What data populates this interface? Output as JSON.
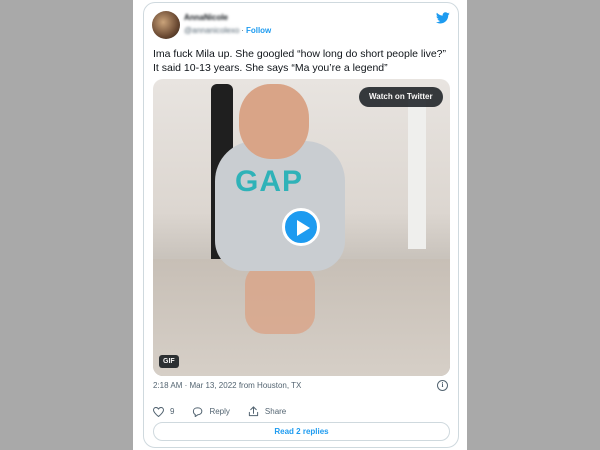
{
  "tweet": {
    "author_name": "AnnaNicole",
    "author_handle": "@annanicolexo",
    "separator": "·",
    "follow_label": "Follow",
    "text": "Ima fuck Mila up. She googled “how long do short people live?” It said 10-13 years. She says “Ma you’re a legend”",
    "timestamp": "2:18 AM · Mar 13, 2022 from Houston, TX"
  },
  "media": {
    "watch_label": "Watch on Twitter",
    "gif_label": "GIF",
    "shirt_text": "GAP"
  },
  "actions": {
    "like_count": "9",
    "reply_label": "Reply",
    "share_label": "Share"
  },
  "replies": {
    "label": "Read 2 replies"
  },
  "colors": {
    "accent": "#1d9bf0",
    "text": "#0f1419",
    "muted": "#536471",
    "border": "#cfd9de",
    "backdrop": "#a9a9a9"
  },
  "icons": [
    "twitter-bird-icon",
    "play-icon",
    "info-icon",
    "heart-icon",
    "reply-icon",
    "share-icon"
  ]
}
